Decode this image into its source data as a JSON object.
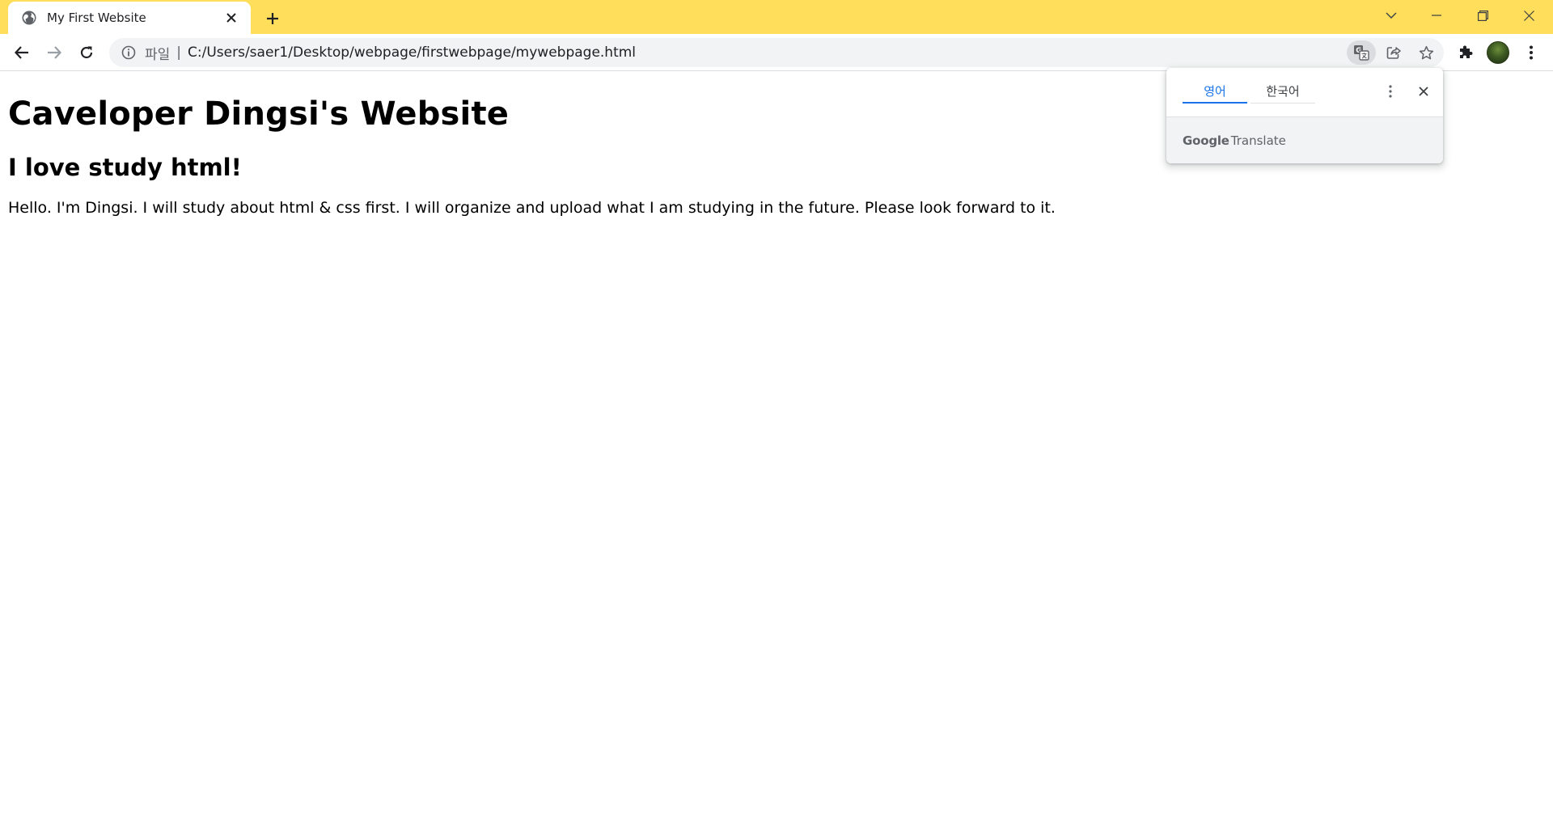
{
  "browser": {
    "tab": {
      "title": "My First Website"
    },
    "omnibox": {
      "scheme_label": "파일",
      "separator": "|",
      "url": "C:/Users/saer1/Desktop/webpage/firstwebpage/mywebpage.html"
    },
    "accent_color": "#ffde5c"
  },
  "translate_popup": {
    "source_language": "영어",
    "target_language": "한국어",
    "footer_brand": "Google",
    "footer_product": "Translate",
    "active_color": "#1a73e8"
  },
  "page": {
    "heading": "Caveloper Dingsi's Website",
    "subheading": "I love study html!",
    "paragraph": "Hello. I'm Dingsi. I will study about html & css first. I will organize and upload what I am studying in the future. Please look forward to it."
  }
}
